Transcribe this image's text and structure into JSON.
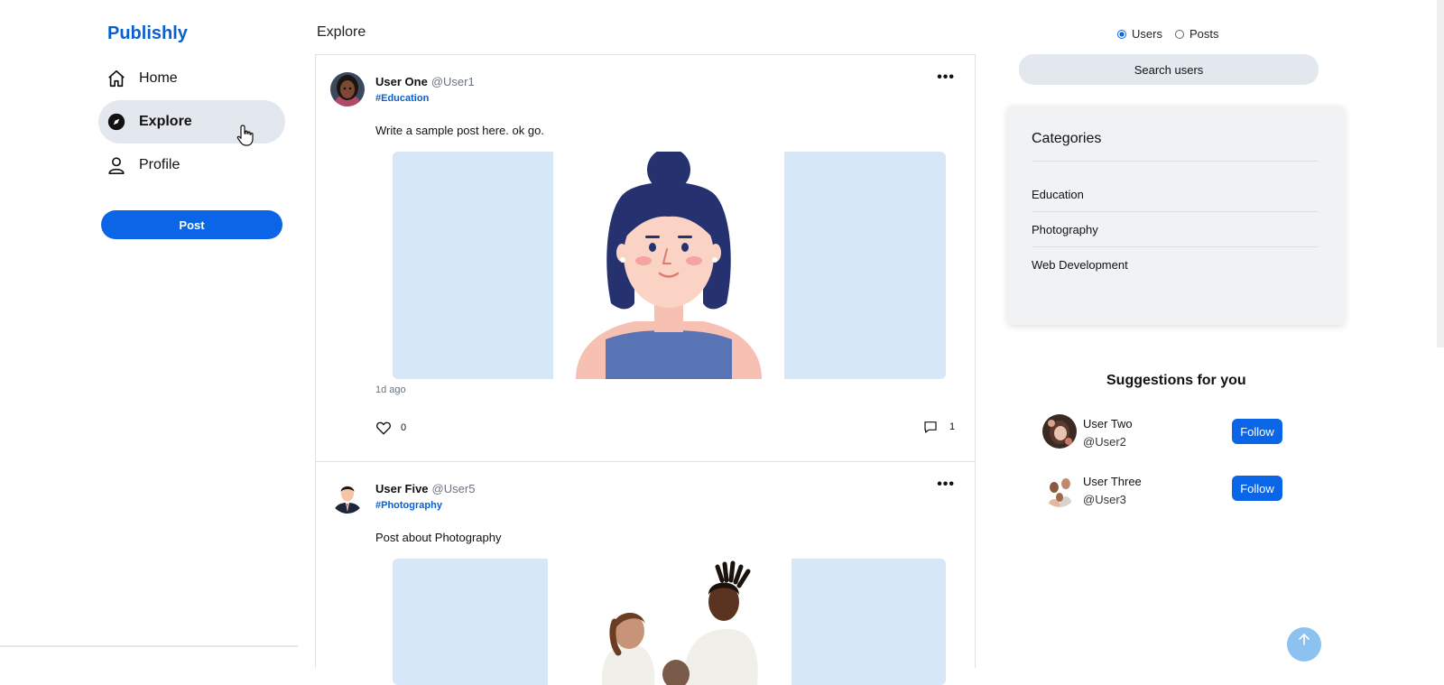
{
  "sidebar": {
    "brand": "Publishly",
    "items": [
      {
        "label": "Home",
        "icon": "home-icon"
      },
      {
        "label": "Explore",
        "icon": "compass-icon"
      },
      {
        "label": "Profile",
        "icon": "user-icon"
      }
    ],
    "post_label": "Post"
  },
  "feed": {
    "title": "Explore",
    "posts": [
      {
        "name": "User One",
        "handle": "@User1",
        "tag": "#Education",
        "text": "Write a sample post here. ok go.",
        "time": "1d ago",
        "likes": "0",
        "comments": "1"
      },
      {
        "name": "User Five",
        "handle": "@User5",
        "tag": "#Photography",
        "text": "Post about Photography"
      }
    ]
  },
  "search": {
    "options": [
      "Users",
      "Posts"
    ],
    "selected": "Users",
    "placeholder": "Search users"
  },
  "categories": {
    "title": "Categories",
    "items": [
      "Education",
      "Photography",
      "Web Development"
    ]
  },
  "suggestions": {
    "title": "Suggestions for you",
    "users": [
      {
        "name": "User Two",
        "handle": "@User2",
        "button": "Follow"
      },
      {
        "name": "User Three",
        "handle": "@User3",
        "button": "Follow"
      }
    ]
  },
  "colors": {
    "brand": "#0a5fcf",
    "primary_button": "#0a66e6",
    "nav_active_bg": "#e3e8ef",
    "image_bg": "#d6e8f8"
  }
}
